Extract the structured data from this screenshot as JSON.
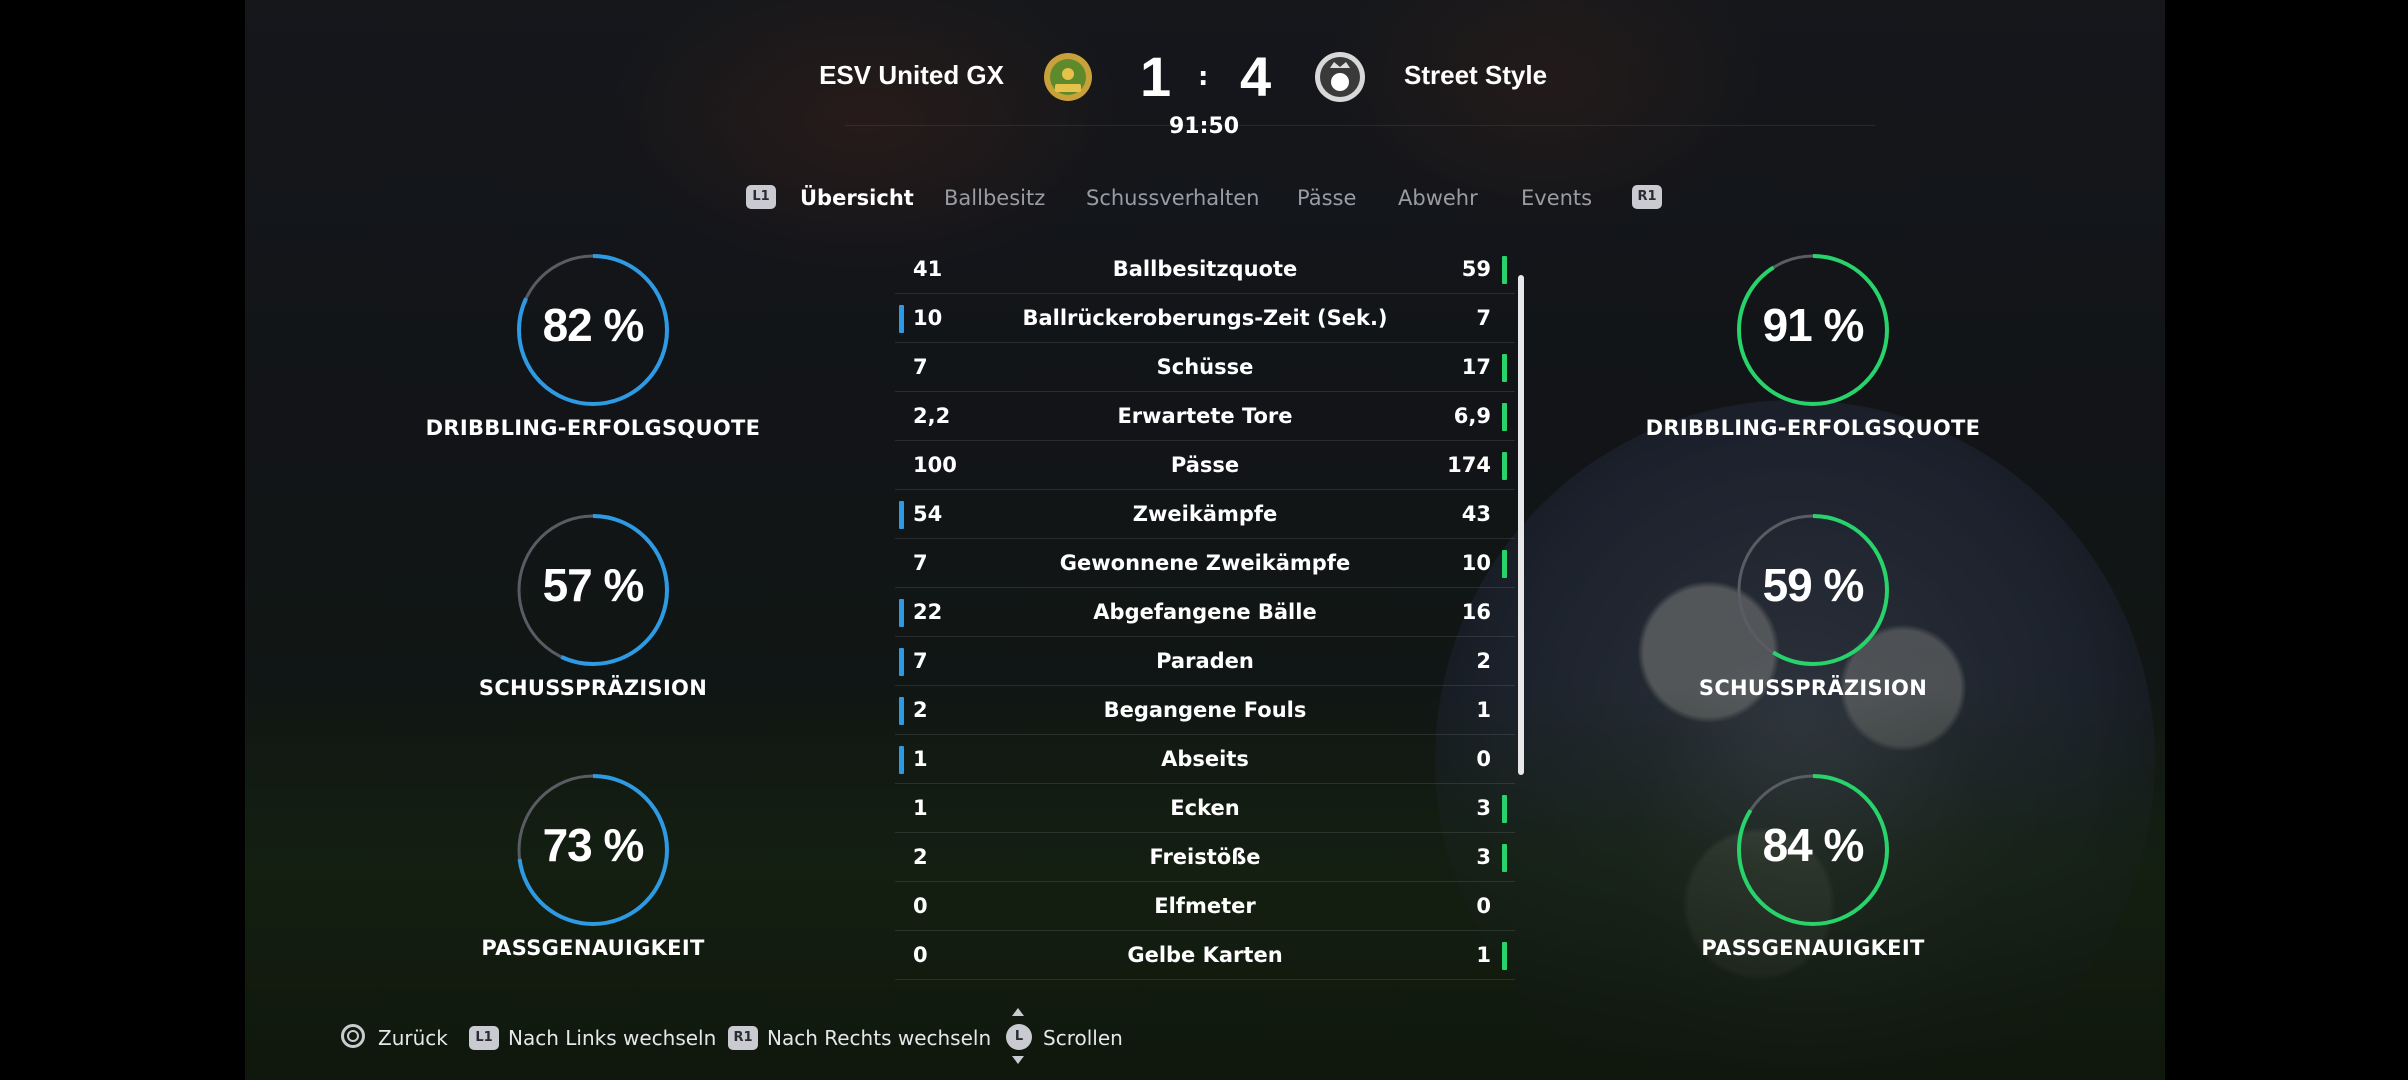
{
  "header": {
    "home_team": "ESV United GX",
    "away_team": "Street Style",
    "home_score": "1",
    "away_score": "4",
    "score_separator": ":",
    "match_time": "91:50"
  },
  "tabs": {
    "left_shoulder": "L1",
    "right_shoulder": "R1",
    "items": [
      "Übersicht",
      "Ballbesitz",
      "Schussverhalten",
      "Pässe",
      "Abwehr",
      "Events"
    ],
    "active_index": 0
  },
  "stats": [
    {
      "label": "Ballbesitzquote",
      "home": "41",
      "away": "59",
      "leader": "away"
    },
    {
      "label": "Ballrückeroberungs-Zeit (Sek.)",
      "home": "10",
      "away": "7",
      "leader": "home"
    },
    {
      "label": "Schüsse",
      "home": "7",
      "away": "17",
      "leader": "away"
    },
    {
      "label": "Erwartete Tore",
      "home": "2,2",
      "away": "6,9",
      "leader": "away"
    },
    {
      "label": "Pässe",
      "home": "100",
      "away": "174",
      "leader": "away"
    },
    {
      "label": "Zweikämpfe",
      "home": "54",
      "away": "43",
      "leader": "home"
    },
    {
      "label": "Gewonnene Zweikämpfe",
      "home": "7",
      "away": "10",
      "leader": "away"
    },
    {
      "label": "Abgefangene Bälle",
      "home": "22",
      "away": "16",
      "leader": "home"
    },
    {
      "label": "Paraden",
      "home": "7",
      "away": "2",
      "leader": "home"
    },
    {
      "label": "Begangene Fouls",
      "home": "2",
      "away": "1",
      "leader": "home"
    },
    {
      "label": "Abseits",
      "home": "1",
      "away": "0",
      "leader": "home"
    },
    {
      "label": "Ecken",
      "home": "1",
      "away": "3",
      "leader": "away"
    },
    {
      "label": "Freistöße",
      "home": "2",
      "away": "3",
      "leader": "away"
    },
    {
      "label": "Elfmeter",
      "home": "0",
      "away": "0",
      "leader": "none"
    },
    {
      "label": "Gelbe Karten",
      "home": "0",
      "away": "1",
      "leader": "away"
    }
  ],
  "gauges": {
    "home": [
      {
        "text": "82 %",
        "value": 82,
        "label": "DRIBBLING-ERFOLGSQUOTE"
      },
      {
        "text": "57 %",
        "value": 57,
        "label": "SCHUSSPRÄZISION"
      },
      {
        "text": "73 %",
        "value": 73,
        "label": "PASSGENAUIGKEIT"
      }
    ],
    "away": [
      {
        "text": "91 %",
        "value": 91,
        "label": "DRIBBLING-ERFOLGSQUOTE"
      },
      {
        "text": "59 %",
        "value": 59,
        "label": "SCHUSSPRÄZISION"
      },
      {
        "text": "84 %",
        "value": 84,
        "label": "PASSGENAUIGKEIT"
      }
    ]
  },
  "footer": {
    "back": "Zurück",
    "left_glyph": "L1",
    "left": "Nach Links wechseln",
    "right_glyph": "R1",
    "right": "Nach Rechts wechseln",
    "scroll_glyph": "L",
    "scroll": "Scrollen"
  },
  "colors": {
    "home_accent": "#2e9ae3",
    "away_accent": "#28d36b",
    "track": "#5a5c63"
  }
}
